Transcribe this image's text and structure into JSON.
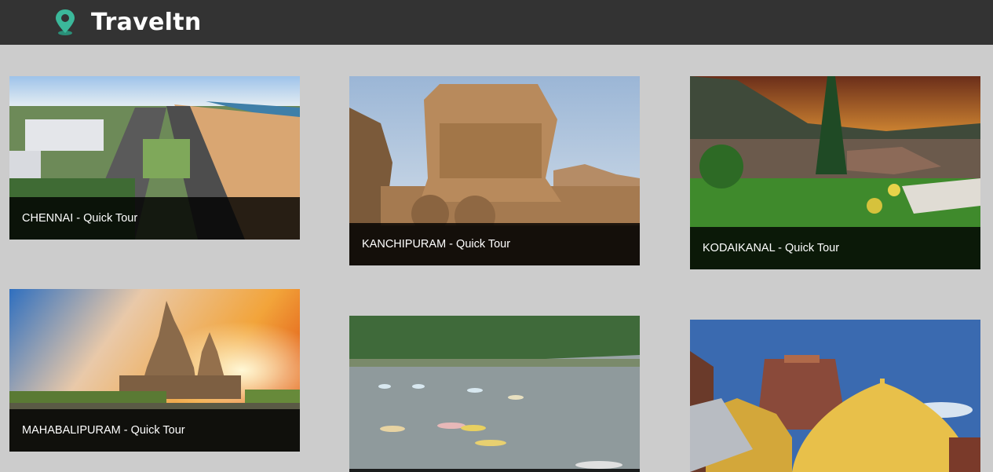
{
  "header": {
    "brand": "Traveltn",
    "logo_icon": "map-pin-icon",
    "background": "#333333"
  },
  "page": {
    "background": "#cccccc"
  },
  "tours": [
    {
      "label": "CHENNAI - Quick Tour",
      "image": "chennai-beach-photo"
    },
    {
      "label": "KANCHIPURAM - Quick Tour",
      "image": "stone-chariot-temple-photo"
    },
    {
      "label": "KODAIKANAL - Quick Tour",
      "image": "hill-station-sunset-photo"
    },
    {
      "label": "MAHABALIPURAM - Quick Tour",
      "image": "shore-temple-sunset-photo"
    },
    {
      "label": "",
      "image": "lake-boating-photo"
    },
    {
      "label": "",
      "image": "golden-temple-dome-photo"
    }
  ]
}
